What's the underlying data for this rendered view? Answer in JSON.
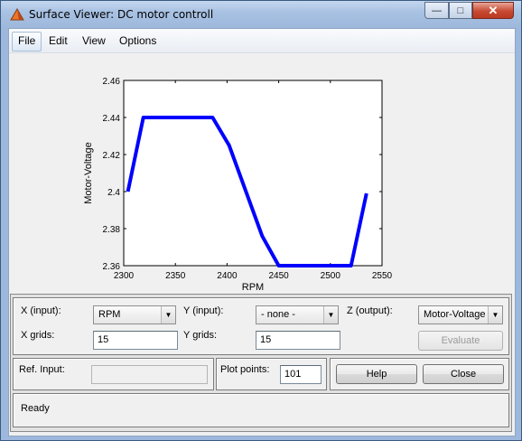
{
  "window": {
    "title": "Surface Viewer: DC motor controll",
    "minimize_glyph": "—",
    "maximize_glyph": "□",
    "close_glyph": "✕"
  },
  "menu": {
    "items": [
      "File",
      "Edit",
      "View",
      "Options"
    ]
  },
  "controls": {
    "x_input_label": "X (input):",
    "x_input_value": "RPM",
    "y_input_label": "Y (input):",
    "y_input_value": "- none -",
    "z_output_label": "Z (output):",
    "z_output_value": "Motor-Voltage",
    "x_grids_label": "X grids:",
    "x_grids_value": "15",
    "y_grids_label": "Y grids:",
    "y_grids_value": "15",
    "evaluate_label": "Evaluate",
    "ref_input_label": "Ref. Input:",
    "ref_input_value": "",
    "plot_points_label": "Plot points:",
    "plot_points_value": "101",
    "help_label": "Help",
    "close_label": "Close",
    "status_text": "Ready",
    "dropdown_arrow": "▼"
  },
  "chart_data": {
    "type": "line",
    "xlabel": "RPM",
    "ylabel": "Motor-Voltage",
    "xlim": [
      2300,
      2550
    ],
    "ylim": [
      2.36,
      2.46
    ],
    "xticks": [
      2300,
      2350,
      2400,
      2450,
      2500,
      2550
    ],
    "yticks": [
      "2.36",
      "2.38",
      "2.4",
      "2.42",
      "2.44",
      "2.46"
    ],
    "line_color": "#0000ff",
    "series": [
      {
        "x": [
          2304,
          2319,
          2386,
          2402,
          2434,
          2450,
          2520,
          2535
        ],
        "y": [
          2.4,
          2.44,
          2.44,
          2.425,
          2.376,
          2.36,
          2.36,
          2.399
        ]
      }
    ]
  }
}
